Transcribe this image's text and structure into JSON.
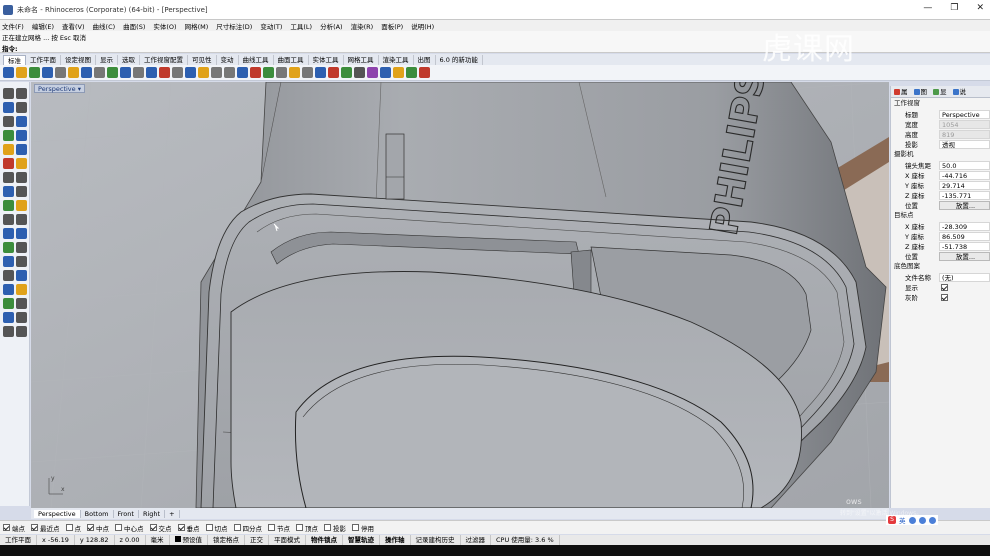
{
  "window": {
    "title": "未命名 - Rhinoceros (Corporate) (64-bit) - [Perspective]",
    "controls": [
      "—",
      "❐",
      "✕"
    ]
  },
  "menu": [
    "文件(F)",
    "编辑(E)",
    "查看(V)",
    "曲线(C)",
    "曲面(S)",
    "实体(O)",
    "网格(M)",
    "尺寸标注(D)",
    "变动(T)",
    "工具(L)",
    "分析(A)",
    "渲染(R)",
    "面板(P)",
    "说明(H)"
  ],
  "command": {
    "history": "正在建立网格 ... 按 Esc 取消",
    "prompt_label": "指令:",
    "value": ""
  },
  "toolbar_tabs": [
    "标准",
    "工作平面",
    "设定视图",
    "显示",
    "选取",
    "工作视窗配置",
    "可见性",
    "变动",
    "曲线工具",
    "曲面工具",
    "实体工具",
    "网格工具",
    "渲染工具",
    "出图",
    "6.0 的新功能"
  ],
  "toolbar_icon_colors": [
    "#2d5fb0",
    "#e0a21a",
    "#3c8d3c",
    "#2d5fb0",
    "#777777",
    "#e0a21a",
    "#2d5fb0",
    "#777777",
    "#3c8d3c",
    "#2d5fb0",
    "#777777",
    "#2d5fb0",
    "#c0392b",
    "#777777",
    "#2d5fb0",
    "#e0a21a",
    "#777777",
    "#777777",
    "#2d5fb0",
    "#c0392b",
    "#3c8d3c",
    "#777777",
    "#e0a21a",
    "#777777",
    "#2d5fb0",
    "#c0392b",
    "#3c8d3c",
    "#555555",
    "#8e44ad",
    "#2d5fb0",
    "#e0a21a",
    "#3c8d3c",
    "#c0392b"
  ],
  "viewport": {
    "label": "Perspective",
    "dropdown_glyph": "▾",
    "axis_x": "x",
    "axis_y": "y",
    "product_text": "PHILIPS"
  },
  "viewport_tabs": [
    "Perspective",
    "Bottom",
    "Front",
    "Right",
    "+"
  ],
  "osnaps": [
    {
      "label": "端点",
      "on": true
    },
    {
      "label": "最近点",
      "on": true
    },
    {
      "label": "点",
      "on": false
    },
    {
      "label": "中点",
      "on": true
    },
    {
      "label": "中心点",
      "on": false
    },
    {
      "label": "交点",
      "on": true
    },
    {
      "label": "垂点",
      "on": true
    },
    {
      "label": "切点",
      "on": false
    },
    {
      "label": "四分点",
      "on": false
    },
    {
      "label": "节点",
      "on": false
    },
    {
      "label": "顶点",
      "on": false
    },
    {
      "label": "投影",
      "on": false
    },
    {
      "label": "停用",
      "on": false
    }
  ],
  "status": {
    "cplane": "工作平面",
    "x": "x -56.19",
    "y": "y 128.82",
    "z": "z 0.00",
    "units": "毫米",
    "layer": "预设值",
    "toggles": [
      "锁定格点",
      "正交",
      "平面模式",
      "物件锁点",
      "智慧轨迹",
      "操作轴",
      "记录建构历史",
      "过滤器"
    ],
    "toggles_bold": [
      false,
      false,
      false,
      true,
      true,
      true,
      false,
      false
    ],
    "cpu": "CPU 使用量: 3.6 %"
  },
  "properties": {
    "tabs": [
      "属",
      "图",
      "显",
      "说"
    ],
    "tab_colors": [
      "#d03b2f",
      "#3b74c9",
      "#4d9a4a",
      "#3b74c9"
    ],
    "viewport_section": "工作视窗",
    "camera_section": "摄影机",
    "target_section": "目标点",
    "background_section": "底色图案",
    "fields": {
      "title": {
        "label": "标题",
        "value": "Perspective"
      },
      "width": {
        "label": "宽度",
        "value": "1054"
      },
      "height": {
        "label": "高度",
        "value": "819"
      },
      "projection": {
        "label": "投影",
        "value": "透视"
      },
      "focal": {
        "label": "镜头焦距",
        "value": "50.0"
      },
      "cam_x": {
        "label": "X 座标",
        "value": "-44.716"
      },
      "cam_y": {
        "label": "Y 座标",
        "value": "29.714"
      },
      "cam_z": {
        "label": "Z 座标",
        "value": "-135.771"
      },
      "cam_pos": {
        "label": "位置",
        "value": "放置..."
      },
      "tgt_x": {
        "label": "X 座标",
        "value": "-28.309"
      },
      "tgt_y": {
        "label": "Y 座标",
        "value": "86.509"
      },
      "tgt_z": {
        "label": "Z 座标",
        "value": "-51.738"
      },
      "tgt_pos": {
        "label": "位置",
        "value": "放置..."
      },
      "file": {
        "label": "文件名称",
        "value": "(无)"
      },
      "show": {
        "label": "显示",
        "on": true
      },
      "gray": {
        "label": "灰阶",
        "on": true
      }
    }
  },
  "watermark": "虎课网",
  "windows_activation": {
    "line1": "ows",
    "line2": "转到\"设置\"以激活 Windows。"
  },
  "ime": {
    "label": "英"
  }
}
